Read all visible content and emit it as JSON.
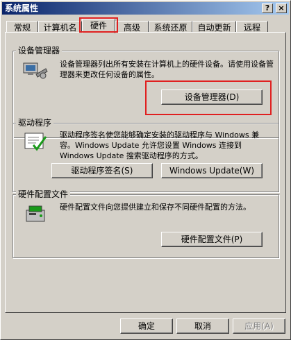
{
  "window": {
    "title": "系统属性",
    "help_button": "?",
    "close_button": "×"
  },
  "tabs": [
    {
      "label": "常规"
    },
    {
      "label": "计算机名"
    },
    {
      "label": "硬件"
    },
    {
      "label": "高级"
    },
    {
      "label": "系统还原"
    },
    {
      "label": "自动更新"
    },
    {
      "label": "远程"
    }
  ],
  "device_manager": {
    "title": "设备管理器",
    "description": "设备管理器列出所有安装在计算机上的硬件设备。请使用设备管理器来更改任何设备的属性。",
    "button": "设备管理器(D)"
  },
  "drivers": {
    "title": "驱动程序",
    "description": "驱动程序签名使您能够确定安装的驱动程序与 Windows 兼容。Windows Update 允许您设置 Windows 连接到 Windows Update 搜索驱动程序的方式。",
    "signing_button": "驱动程序签名(S)",
    "update_button": "Windows Update(W)"
  },
  "hardware_profiles": {
    "title": "硬件配置文件",
    "description": "硬件配置文件向您提供建立和保存不同硬件配置的方法。",
    "button": "硬件配置文件(P)"
  },
  "footer": {
    "ok": "确定",
    "cancel": "取消",
    "apply": "应用(A)"
  },
  "colors": {
    "highlight": "#e02020",
    "titlebar": "#0a246a",
    "face": "#d4d0c8"
  },
  "icons": [
    "device-manager-icon",
    "driver-signing-icon",
    "hardware-profile-icon"
  ]
}
